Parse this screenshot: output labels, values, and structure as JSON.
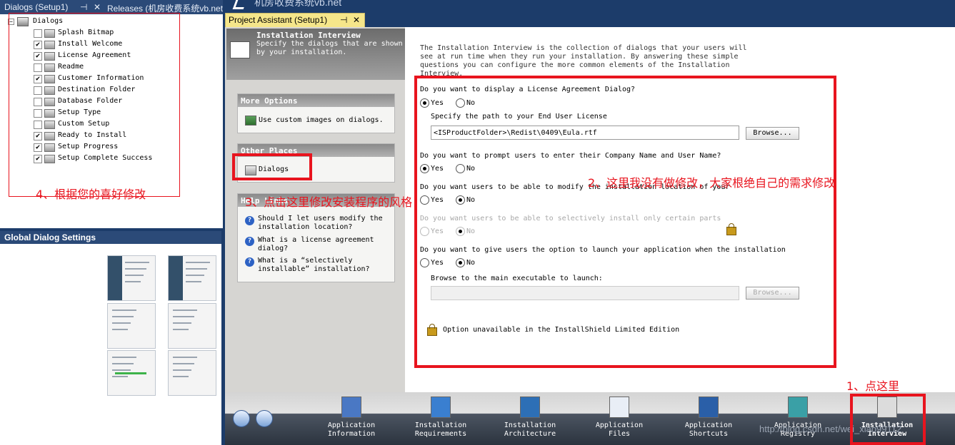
{
  "left_tabs": {
    "dialogs_tab": "Dialogs (Setup1)",
    "pin": "⊣",
    "close": "✕",
    "releases_tab": "Releases (机房收费系统vb.net"
  },
  "dialogs_tree": {
    "root": "Dialogs",
    "items": [
      {
        "label": "Splash Bitmap",
        "checked": false
      },
      {
        "label": "Install Welcome",
        "checked": true
      },
      {
        "label": "License Agreement",
        "checked": true
      },
      {
        "label": "Readme",
        "checked": false
      },
      {
        "label": "Customer Information",
        "checked": true
      },
      {
        "label": "Destination Folder",
        "checked": false
      },
      {
        "label": "Database Folder",
        "checked": false
      },
      {
        "label": "Setup Type",
        "checked": false
      },
      {
        "label": "Custom Setup",
        "checked": false
      },
      {
        "label": "Ready to Install",
        "checked": true
      },
      {
        "label": "Setup Progress",
        "checked": true
      },
      {
        "label": "Setup Complete Success",
        "checked": true
      }
    ]
  },
  "global_dialog_settings": "Global Dialog Settings",
  "window_title": "机房收费系统vb.net",
  "project_assistant_tab": {
    "label": "Project Assistant (Setup1)",
    "pin": "⊣",
    "close": "✕"
  },
  "header": {
    "title": "Installation Interview",
    "desc": "Specify the dialogs that are shown by your installation."
  },
  "more_options": {
    "title": "More Options",
    "item": "Use custom images on dialogs."
  },
  "other_places": {
    "title": "Other Places",
    "item": "Dialogs"
  },
  "help_links": {
    "title": "Help Links",
    "items": [
      "Should I let users modify the installation location?",
      "What is a license agreement dialog?",
      "What is a “selectively installable” installation?"
    ]
  },
  "intro": "The Installation Interview is the collection of dialogs that your users will see at run time when they run your installation. By answering these simple questions you can configure the more common elements of the Installation Interview.",
  "form": {
    "q1": "Do you want to display a License Agreement Dialog?",
    "q1_answer": "Yes",
    "license_path_label": "Specify the path to your End User License",
    "license_path": "<ISProductFolder>\\Redist\\0409\\Eula.rtf",
    "browse": "Browse...",
    "q2": "Do you want to prompt users to enter their Company Name and User Name?",
    "q2_answer": "Yes",
    "q3": "Do you want users to be able to modify the installation location of your",
    "q3_answer": "No",
    "q4": "Do you want users to be able to selectively install only certain parts",
    "q4_answer": "No",
    "q5": "Do you want to give users the option to launch your application when the installation",
    "q5_answer": "No",
    "exe_label": "Browse to the main executable to launch:",
    "exe_value": "",
    "yes": "Yes",
    "no": "No",
    "limited_note": "Option unavailable in the InstallShield Limited Edition"
  },
  "annotations": {
    "a1": "1、点这里",
    "a2": "2、这里我没有做修改，大家根绝自己的需求修改",
    "a3": "3、点击这里修改安装程序的风格",
    "a4": "4、根据您的喜好修改"
  },
  "nav_items": [
    {
      "label": "Application\nInformation",
      "icon": "application-information-icon"
    },
    {
      "label": "Installation\nRequirements",
      "icon": "installation-requirements-icon"
    },
    {
      "label": "Installation\nArchitecture",
      "icon": "installation-architecture-icon"
    },
    {
      "label": "Application\nFiles",
      "icon": "application-files-icon"
    },
    {
      "label": "Application\nShortcuts",
      "icon": "application-shortcuts-icon"
    },
    {
      "label": "Application\nRegistry",
      "icon": "application-registry-icon"
    },
    {
      "label": "Installation\nInterview",
      "icon": "installation-interview-icon"
    }
  ],
  "watermark": "http://blog.csdn.net/wei_xiao99112",
  "colors": {
    "annotation_red": "#e8141e",
    "nav_dark": "#2b333e",
    "tab_yellow": "#f5e68a"
  }
}
